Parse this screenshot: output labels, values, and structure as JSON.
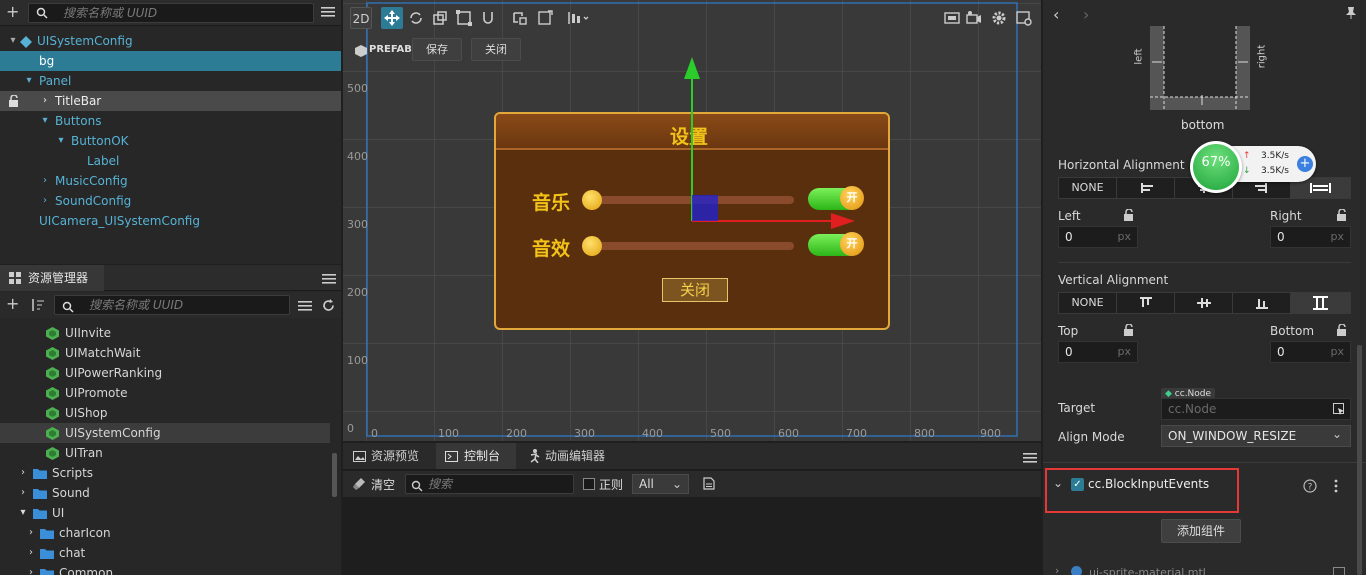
{
  "hierarchy": {
    "search_placeholder": "搜索名称或 UUID",
    "items": [
      {
        "label": "UISystemConfig"
      },
      {
        "label": "bg"
      },
      {
        "label": "Panel"
      },
      {
        "label": "TitleBar"
      },
      {
        "label": "Buttons"
      },
      {
        "label": "ButtonOK"
      },
      {
        "label": "Label"
      },
      {
        "label": "MusicConfig"
      },
      {
        "label": "SoundConfig"
      },
      {
        "label": "UICamera_UISystemConfig"
      }
    ]
  },
  "assets": {
    "tab_label": "资源管理器",
    "search_placeholder": "搜索名称或 UUID",
    "items": [
      {
        "label": "UIInvite"
      },
      {
        "label": "UIMatchWait"
      },
      {
        "label": "UIPowerRanking"
      },
      {
        "label": "UIPromote"
      },
      {
        "label": "UIShop"
      },
      {
        "label": "UISystemConfig"
      },
      {
        "label": "UITran"
      },
      {
        "label": "Scripts"
      },
      {
        "label": "Sound"
      },
      {
        "label": "UI"
      },
      {
        "label": "charIcon"
      },
      {
        "label": "chat"
      },
      {
        "label": "Common"
      }
    ]
  },
  "scene": {
    "mode_label": "2D",
    "prefab_label": "PREFAB",
    "save_label": "保存",
    "close_label": "关闭",
    "y_ticks": [
      "500",
      "400",
      "300",
      "200",
      "100",
      "0"
    ],
    "x_ticks": [
      "0",
      "100",
      "200",
      "300",
      "400",
      "500",
      "600",
      "700",
      "800",
      "900"
    ],
    "dialog": {
      "title": "设置",
      "music_label": "音乐",
      "sound_label": "音效",
      "toggle_label": "开",
      "close_button": "关闭"
    }
  },
  "console": {
    "tabs": [
      "资源预览",
      "控制台",
      "动画编辑器"
    ],
    "clear_label": "清空",
    "search_placeholder": "搜索",
    "regex_label": "正则",
    "filter_value": "All"
  },
  "inspector": {
    "left_text": "left",
    "right_text": "right",
    "bottom_text": "bottom",
    "h_align_label": "Horizontal Alignment",
    "v_align_label": "Vertical Alignment",
    "none_label": "NONE",
    "left_label": "Left",
    "right_label": "Right",
    "top_label": "Top",
    "bottom_label": "Bottom",
    "left_value": "0",
    "right_value": "0",
    "top_value": "0",
    "bottom_value": "0",
    "unit": "px",
    "target_label": "Target",
    "target_type": "cc.Node",
    "target_placeholder": "cc.Node",
    "align_mode_label": "Align Mode",
    "align_mode_value": "ON_WINDOW_RESIZE",
    "component_name": "cc.BlockInputEvents",
    "add_component_label": "添加组件",
    "material_label": "ui-sprite-material.mtl"
  },
  "net_widget": {
    "percent": "67%",
    "up_rate": "3.5K/s",
    "down_rate": "3.5K/s",
    "percent_value": 67
  },
  "colors": {
    "selection": "#2d7c95",
    "accent_blue": "#56b3d6",
    "highlight_red": "#e53935",
    "dialog_title": "#f0c21a"
  }
}
